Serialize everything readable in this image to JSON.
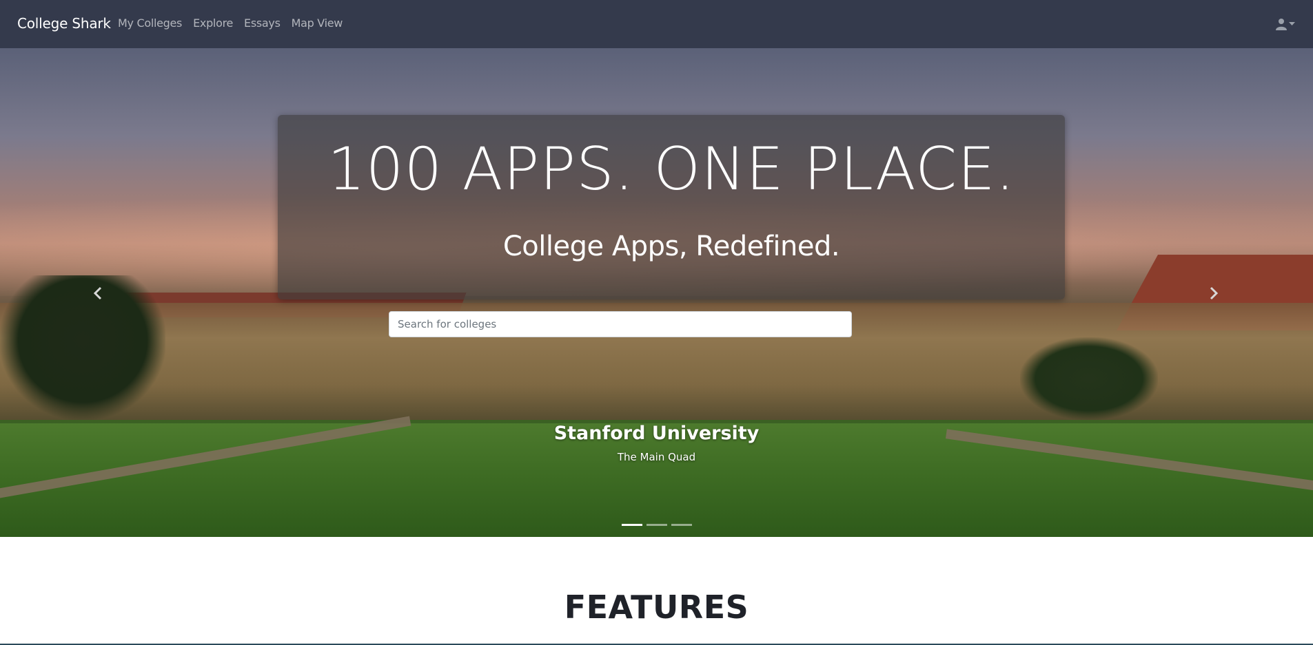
{
  "navbar": {
    "brand": "College Shark",
    "links": [
      "My Colleges",
      "Explore",
      "Essays",
      "Map View"
    ],
    "user_icon": "user-icon",
    "dropdown_icon": "caret-down-icon"
  },
  "hero": {
    "title": "100 APPS. ONE PLACE.",
    "subtitle": "College Apps, Redefined.",
    "search": {
      "placeholder": "Search for colleges",
      "value": ""
    },
    "slide": {
      "title": "Stanford University",
      "subtitle": "The Main Quad"
    },
    "indicators": {
      "count": 3,
      "active_index": 0
    },
    "prev_icon": "chevron-left-icon",
    "next_icon": "chevron-right-icon"
  },
  "features": {
    "heading": "FEATURES"
  },
  "colors": {
    "navbar_bg": "#343a4c",
    "hero_card_bg": "rgba(60,58,58,0.62)",
    "text_dark": "#1f2229"
  }
}
